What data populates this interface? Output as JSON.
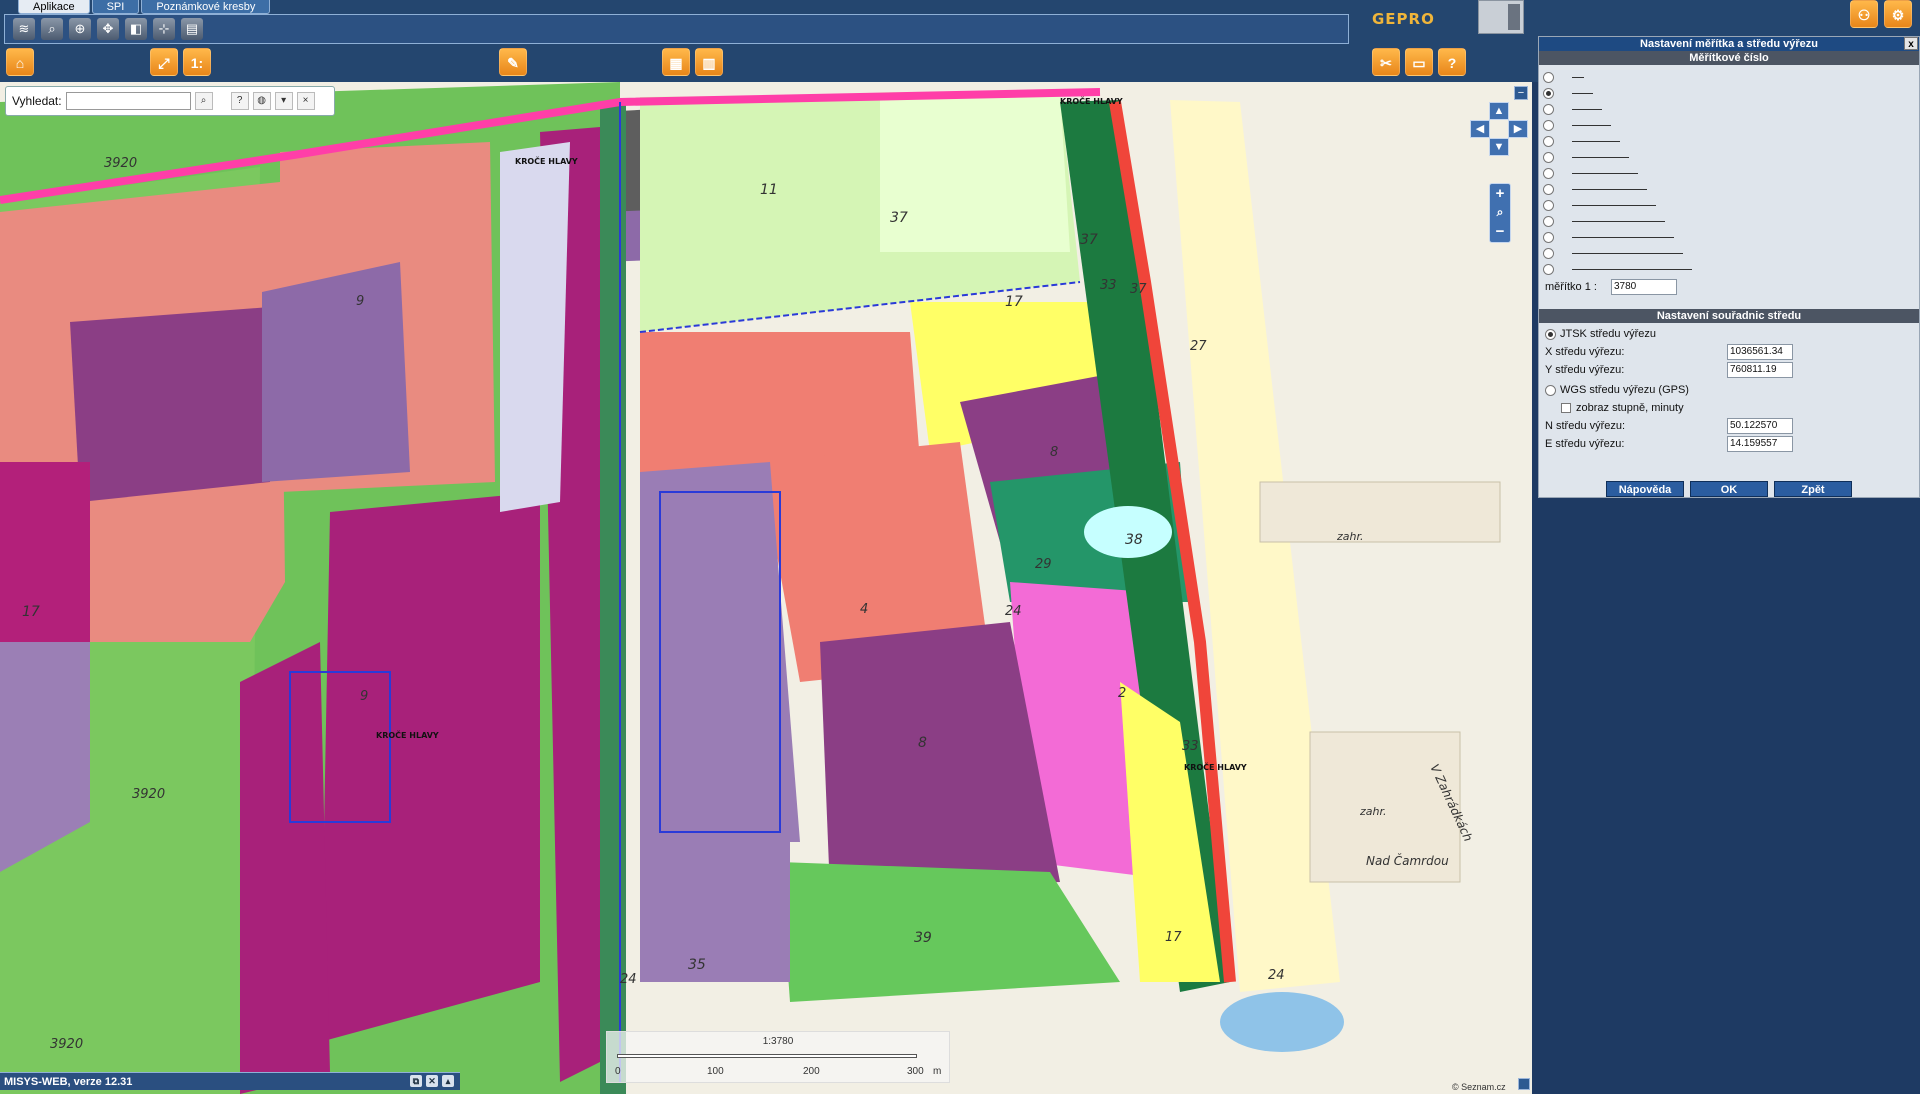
{
  "tabs": [
    {
      "label": "Aplikace",
      "active": true
    },
    {
      "label": "SPI",
      "active": false
    },
    {
      "label": "Poznámkové kresby",
      "active": false
    }
  ],
  "brand": "GEPRO",
  "search": {
    "label": "Vyhledat:",
    "value": "",
    "placeholder": ""
  },
  "map": {
    "labels": [
      {
        "text": "37"
      },
      {
        "text": "37"
      },
      {
        "text": "37"
      },
      {
        "text": "17"
      },
      {
        "text": "8"
      },
      {
        "text": "38"
      },
      {
        "text": "29"
      },
      {
        "text": "24"
      },
      {
        "text": "2"
      },
      {
        "text": "33"
      },
      {
        "text": "8"
      },
      {
        "text": "4"
      },
      {
        "text": "39"
      },
      {
        "text": "35"
      },
      {
        "text": "24"
      },
      {
        "text": "17"
      },
      {
        "text": "9"
      },
      {
        "text": "9"
      },
      {
        "text": "11"
      },
      {
        "text": "33"
      },
      {
        "text": "27"
      },
      {
        "text": "24"
      },
      {
        "text": "3920"
      },
      {
        "text": "3920"
      },
      {
        "text": "3920"
      },
      {
        "text": "17"
      },
      {
        "text": "zahr."
      },
      {
        "text": "zahr."
      },
      {
        "text": "Nad Čamrdou"
      },
      {
        "text": "V Zahrádkách"
      },
      {
        "text": "KROČE HLAVY"
      },
      {
        "text": "KROČE HLAVY"
      },
      {
        "text": "KROČE HLAVY"
      },
      {
        "text": "KROČE HLAVY"
      }
    ]
  },
  "scalebar": {
    "caption": "1:3780",
    "ticks": [
      "0",
      "100",
      "200",
      "300"
    ],
    "unit": "m"
  },
  "status": {
    "version": "MISYS-WEB, verze 12.31"
  },
  "copyright": "© Seznam.cz",
  "panel": {
    "title": "Nastavení měřítka a středu výřezu",
    "close": "x",
    "scale_section": "Měřítkové číslo",
    "scale_options": [
      {
        "selected": false
      },
      {
        "selected": true
      },
      {
        "selected": false
      },
      {
        "selected": false
      },
      {
        "selected": false
      },
      {
        "selected": false
      },
      {
        "selected": false
      },
      {
        "selected": false
      },
      {
        "selected": false
      },
      {
        "selected": false
      },
      {
        "selected": false
      },
      {
        "selected": false
      },
      {
        "selected": false
      }
    ],
    "scale_label": "měřítko  1 :",
    "scale_value": "3780",
    "coords_section": "Nastavení souřadnic středu",
    "jtsk_label": "JTSK středu výřezu",
    "x_label": "X středu výřezu:",
    "x_value": "1036561.34",
    "y_label": "Y středu výřezu:",
    "y_value": "760811.19",
    "wgs_label": "WGS středu výřezu (GPS)",
    "dms_label": "zobraz stupně, minuty",
    "n_label": "N středu výřezu:",
    "n_value": "50.122570",
    "e_label": "E středu výřezu:",
    "e_value": "14.159557",
    "btn_help": "Nápověda",
    "btn_ok": "OK",
    "btn_back": "Zpět"
  },
  "colors": {
    "chrome": "#24466f",
    "accent": "#2b5da0",
    "orange": "#f0a030"
  }
}
